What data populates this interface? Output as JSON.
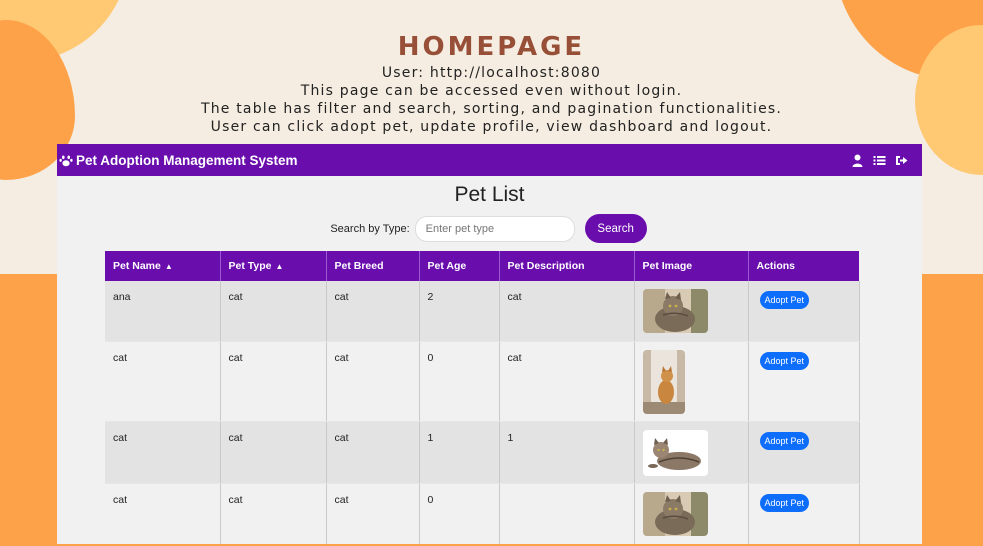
{
  "caption": {
    "heading": "HOMEPAGE",
    "lines": [
      "User: http://localhost:8080",
      "This page can be accessed even without login.",
      "The table has filter and search, sorting, and pagination functionalities.",
      "User can click adopt pet, update profile, view dashboard and logout."
    ]
  },
  "navbar": {
    "brand": "Pet Adoption Management System",
    "brand_icon": "paw-icon",
    "icons": [
      "user-icon",
      "list-icon",
      "logout-icon"
    ]
  },
  "page": {
    "title": "Pet List",
    "search": {
      "label": "Search by Type:",
      "placeholder": "Enter pet type",
      "value": "",
      "button": "Search"
    }
  },
  "table": {
    "headers": [
      "Pet Name",
      "Pet Type",
      "Pet Breed",
      "Pet Age",
      "Pet Description",
      "Pet Image",
      "Actions"
    ],
    "sort_indicator": "▲",
    "rows": [
      {
        "name": "ana",
        "type": "cat",
        "breed": "cat",
        "age": "2",
        "description": "cat",
        "image": "tabby-cat-photo",
        "action": "Adopt Pet"
      },
      {
        "name": "cat",
        "type": "cat",
        "breed": "cat",
        "age": "0",
        "description": "cat",
        "image": "orange-cat-window-photo",
        "action": "Adopt Pet"
      },
      {
        "name": "cat",
        "type": "cat",
        "breed": "cat",
        "age": "1",
        "description": "1",
        "image": "lying-tabby-cat-photo",
        "action": "Adopt Pet"
      },
      {
        "name": "cat",
        "type": "cat",
        "breed": "cat",
        "age": "0",
        "description": "",
        "image": "tabby-cat-photo",
        "action": "Adopt Pet"
      }
    ]
  },
  "colors": {
    "primary_purple": "#6a0dad",
    "button_blue": "#0d6efd",
    "heading_brown": "#984f37",
    "accent_orange": "#fea24a"
  }
}
